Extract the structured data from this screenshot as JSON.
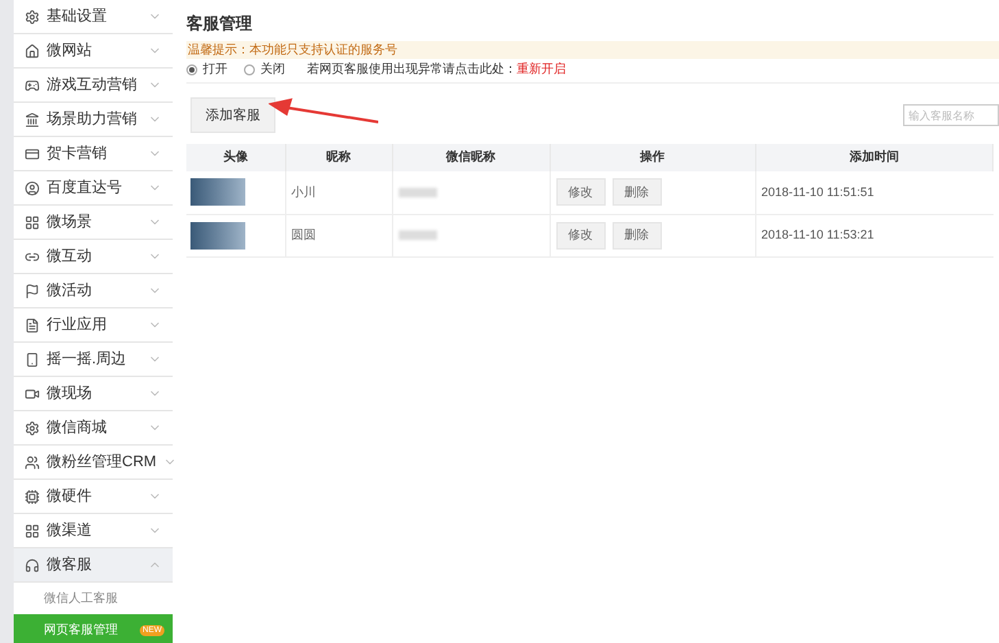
{
  "sidebar": {
    "items": [
      {
        "label": "基础设置",
        "expanded": false
      },
      {
        "label": "微网站",
        "expanded": false
      },
      {
        "label": "游戏互动营销",
        "expanded": false
      },
      {
        "label": "场景助力营销",
        "expanded": false
      },
      {
        "label": "贺卡营销",
        "expanded": false
      },
      {
        "label": "百度直达号",
        "expanded": false
      },
      {
        "label": "微场景",
        "expanded": false
      },
      {
        "label": "微互动",
        "expanded": false
      },
      {
        "label": "微活动",
        "expanded": false
      },
      {
        "label": "行业应用",
        "expanded": false
      },
      {
        "label": "摇一摇.周边",
        "expanded": false
      },
      {
        "label": "微现场",
        "expanded": false
      },
      {
        "label": "微信商城",
        "expanded": false
      },
      {
        "label": "微粉丝管理CRM",
        "expanded": false
      },
      {
        "label": "微硬件",
        "expanded": false
      },
      {
        "label": "微渠道",
        "expanded": false
      },
      {
        "label": "微客服",
        "expanded": true,
        "children": [
          {
            "label": "微信人工客服",
            "selected": false
          },
          {
            "label": "网页客服管理",
            "selected": true,
            "badge": "NEW"
          }
        ]
      }
    ]
  },
  "page_title": "客服管理",
  "notice": "温馨提示：本功能只支持认证的服务号",
  "status_options": [
    {
      "label": "打开",
      "selected": true
    },
    {
      "label": "关闭",
      "selected": false
    }
  ],
  "reset_hint": "若网页客服使用出现异常请点击此处：",
  "reset_link": "重新开启",
  "add_button": "添加客服",
  "search": {
    "placeholder": "输入客服名称"
  },
  "table": {
    "columns": [
      "头像",
      "昵称",
      "微信昵称",
      "操作",
      "添加时间"
    ],
    "rows": [
      {
        "nickname": "小川",
        "actions": [
          "修改",
          "删除"
        ],
        "added": "2018-11-10 11:51:51"
      },
      {
        "nickname": "圆圆",
        "actions": [
          "修改",
          "删除"
        ],
        "added": "2018-11-10 11:53:21"
      }
    ]
  }
}
